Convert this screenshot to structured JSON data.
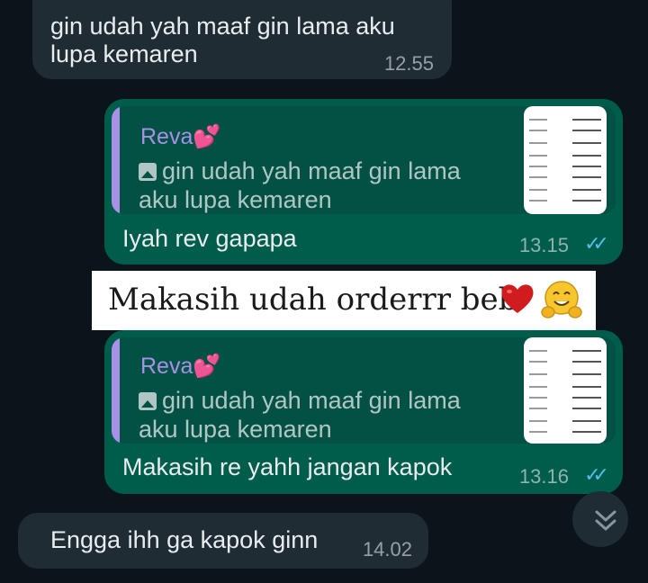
{
  "messages": [
    {
      "id": "m1",
      "direction": "incoming",
      "text_line1": "gin udah yah maaf gin lama aku",
      "text_line2": "lupa kemaren",
      "time": "12.55"
    },
    {
      "id": "m2",
      "direction": "outgoing",
      "quote": {
        "sender": "Reva💕",
        "text_line1": "gin udah yah maaf gin lama",
        "text_line2": "aku lupa kemaren"
      },
      "text": "Iyah rev gapapa",
      "time": "13.15"
    },
    {
      "id": "m3",
      "direction": "outgoing",
      "quote": {
        "sender": "Reva💕",
        "text_line1": "gin udah yah maaf gin lama",
        "text_line2": "aku lupa kemaren"
      },
      "text": "Makasih re yahh jangan kapok",
      "time": "13.16"
    },
    {
      "id": "m4",
      "direction": "incoming",
      "text": "Engga ihh ga kapok ginn",
      "time": "14.02"
    }
  ],
  "sticker": {
    "text": "Makasih udah orderrr beb"
  },
  "icons": {
    "read_receipt": "double-check-icon",
    "quoted_media": "image-icon",
    "scroll_down": "chevron-double-down-icon",
    "heart": "heart-emoji",
    "hug": "hugging-face-emoji"
  },
  "colors": {
    "background": "#0b141a",
    "incoming_bubble": "#1f2c34",
    "outgoing_bubble": "#005c4b",
    "quote_accent": "#a791e6",
    "read_tick": "#53bdeb"
  }
}
